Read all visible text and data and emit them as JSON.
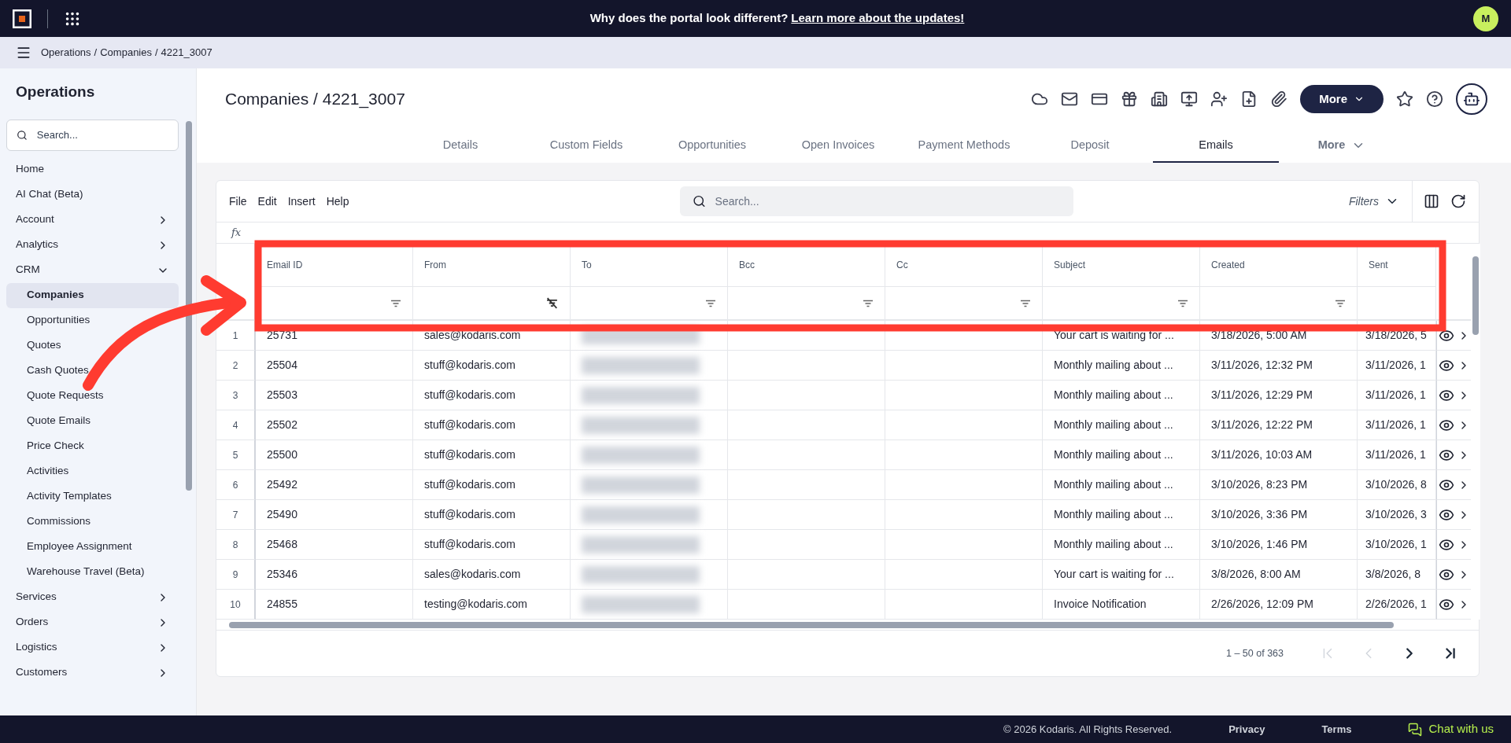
{
  "top_bar": {
    "message": "Why does the portal look different?",
    "link": "Learn more about the updates!",
    "avatar": "M"
  },
  "breadcrumb": {
    "separator": "/",
    "items": [
      "Operations",
      "Companies",
      "4221_3007"
    ]
  },
  "sidebar": {
    "title": "Operations",
    "search_placeholder": "Search...",
    "items": [
      {
        "label": "Home",
        "kind": "link",
        "selected": false
      },
      {
        "label": "AI Chat (Beta)",
        "kind": "link",
        "selected": false
      },
      {
        "label": "Account",
        "kind": "group",
        "expanded": false,
        "selected": false
      },
      {
        "label": "Analytics",
        "kind": "group",
        "expanded": false,
        "selected": false
      },
      {
        "label": "CRM",
        "kind": "group",
        "expanded": true,
        "selected": false,
        "children": [
          {
            "label": "Companies",
            "selected": true
          },
          {
            "label": "Opportunities",
            "selected": false
          },
          {
            "label": "Quotes",
            "selected": false
          },
          {
            "label": "Cash Quotes",
            "selected": false
          },
          {
            "label": "Quote Requests",
            "selected": false
          },
          {
            "label": "Quote Emails",
            "selected": false
          },
          {
            "label": "Price Check",
            "selected": false
          },
          {
            "label": "Activities",
            "selected": false
          },
          {
            "label": "Activity Templates",
            "selected": false
          },
          {
            "label": "Commissions",
            "selected": false
          },
          {
            "label": "Employee Assignment",
            "selected": false
          },
          {
            "label": "Warehouse Travel (Beta)",
            "selected": false
          }
        ]
      },
      {
        "label": "Services",
        "kind": "group",
        "expanded": false,
        "selected": false
      },
      {
        "label": "Orders",
        "kind": "group",
        "expanded": false,
        "selected": false
      },
      {
        "label": "Logistics",
        "kind": "group",
        "expanded": false,
        "selected": false
      },
      {
        "label": "Customers",
        "kind": "group",
        "expanded": false,
        "selected": false
      }
    ]
  },
  "page": {
    "title": "Companies / 4221_3007",
    "more_button": "More"
  },
  "tabs": [
    {
      "label": "Details",
      "selected": false
    },
    {
      "label": "Custom Fields",
      "selected": false
    },
    {
      "label": "Opportunities",
      "selected": false
    },
    {
      "label": "Open Invoices",
      "selected": false
    },
    {
      "label": "Payment Methods",
      "selected": false
    },
    {
      "label": "Deposit",
      "selected": false
    },
    {
      "label": "Emails",
      "selected": true
    },
    {
      "label": "More",
      "selected": false
    }
  ],
  "grid": {
    "menu": [
      "File",
      "Edit",
      "Insert",
      "Help"
    ],
    "search_placeholder": "Search...",
    "filters": "Filters",
    "formula_label": "fx",
    "columns": [
      {
        "label": "Email ID",
        "kind": "filterable"
      },
      {
        "label": "From",
        "kind": "filtered"
      },
      {
        "label": "To",
        "kind": "filterable",
        "redacted": true
      },
      {
        "label": "Bcc",
        "kind": "filterable"
      },
      {
        "label": "Cc",
        "kind": "filterable"
      },
      {
        "label": "Subject",
        "kind": "filterable"
      },
      {
        "label": "Created",
        "kind": "filterable"
      },
      {
        "label": "Sent",
        "kind": "plain"
      }
    ],
    "rows": [
      {
        "num": "1",
        "email_id": "25731",
        "from": "sales@kodaris.com",
        "subject": "Your cart is waiting for ...",
        "created": "3/18/2026, 5:00 AM",
        "sent": "3/18/2026, 5"
      },
      {
        "num": "2",
        "email_id": "25504",
        "from": "stuff@kodaris.com",
        "subject": "Monthly mailing about ...",
        "created": "3/11/2026, 12:32 PM",
        "sent": "3/11/2026, 1"
      },
      {
        "num": "3",
        "email_id": "25503",
        "from": "stuff@kodaris.com",
        "subject": "Monthly mailing about ...",
        "created": "3/11/2026, 12:29 PM",
        "sent": "3/11/2026, 1"
      },
      {
        "num": "4",
        "email_id": "25502",
        "from": "stuff@kodaris.com",
        "subject": "Monthly mailing about ...",
        "created": "3/11/2026, 12:22 PM",
        "sent": "3/11/2026, 1"
      },
      {
        "num": "5",
        "email_id": "25500",
        "from": "stuff@kodaris.com",
        "subject": "Monthly mailing about ...",
        "created": "3/11/2026, 10:03 AM",
        "sent": "3/11/2026, 1"
      },
      {
        "num": "6",
        "email_id": "25492",
        "from": "stuff@kodaris.com",
        "subject": "Monthly mailing about ...",
        "created": "3/10/2026, 8:23 PM",
        "sent": "3/10/2026, 8"
      },
      {
        "num": "7",
        "email_id": "25490",
        "from": "stuff@kodaris.com",
        "subject": "Monthly mailing about ...",
        "created": "3/10/2026, 3:36 PM",
        "sent": "3/10/2026, 3"
      },
      {
        "num": "8",
        "email_id": "25468",
        "from": "stuff@kodaris.com",
        "subject": "Monthly mailing about ...",
        "created": "3/10/2026, 1:46 PM",
        "sent": "3/10/2026, 1"
      },
      {
        "num": "9",
        "email_id": "25346",
        "from": "sales@kodaris.com",
        "subject": "Your cart is waiting for ...",
        "created": "3/8/2026, 8:00 AM",
        "sent": "3/8/2026, 8"
      },
      {
        "num": "10",
        "email_id": "24855",
        "from": "testing@kodaris.com",
        "subject": "Invoice Notification",
        "created": "2/26/2026, 12:09 PM",
        "sent": "2/26/2026, 1"
      }
    ],
    "range": "1 – 50 of 363",
    "pager": [
      {
        "kind": "first",
        "disabled": true
      },
      {
        "kind": "prev",
        "disabled": true
      },
      {
        "kind": "next",
        "disabled": false
      },
      {
        "kind": "last",
        "disabled": false
      }
    ]
  },
  "footer": {
    "copyright": "© 2026 Kodaris. All Rights Reserved.",
    "links": [
      "Privacy",
      "Terms"
    ],
    "chat": "Chat with us"
  }
}
